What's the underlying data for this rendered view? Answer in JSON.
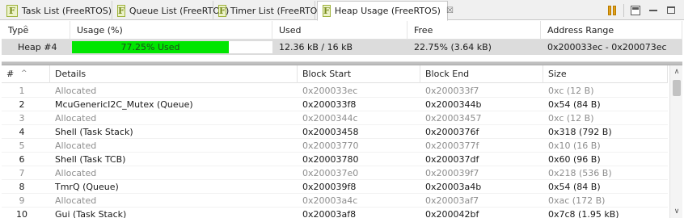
{
  "tabs": [
    {
      "label": "Task List (FreeRTOS)",
      "icon": "freertos-icon",
      "active": false
    },
    {
      "label": "Queue List (FreeRTOS)",
      "icon": "freertos-icon",
      "active": false
    },
    {
      "label": "Timer List (FreeRTOS)",
      "icon": "freertos-icon",
      "active": false
    },
    {
      "label": "Heap Usage (FreeRTOS)",
      "icon": "freertos-icon",
      "active": true,
      "close": "☒"
    }
  ],
  "toolbar": {
    "icons": [
      "pause-icon",
      "save-icon",
      "minimize-icon",
      "maximize-icon"
    ]
  },
  "summary": {
    "headers": {
      "type": "Type",
      "usage": "Usage (%)",
      "used": "Used",
      "free": "Free",
      "address": "Address Range"
    },
    "row": {
      "type": "Heap #4",
      "usage_text": "77.25% Used",
      "usage_fraction": 0.7725,
      "used": "12.36 kB / 16 kB",
      "free": "22.75% (3.64 kB)",
      "address": "0x200033ec - 0x200073ec"
    }
  },
  "blocks": {
    "headers": {
      "num": "#",
      "details": "Details",
      "start": "Block Start",
      "end": "Block End",
      "size": "Size"
    },
    "rows": [
      {
        "num": "1",
        "details": "Allocated",
        "start": "0x200033ec",
        "end": "0x200033f7",
        "size": "0xc (12 B)",
        "grey": true
      },
      {
        "num": "2",
        "details": "McuGenericI2C_Mutex (Queue)",
        "start": "0x200033f8",
        "end": "0x2000344b",
        "size": "0x54 (84 B)",
        "grey": false
      },
      {
        "num": "3",
        "details": "Allocated",
        "start": "0x2000344c",
        "end": "0x20003457",
        "size": "0xc (12 B)",
        "grey": true
      },
      {
        "num": "4",
        "details": "Shell (Task Stack)",
        "start": "0x20003458",
        "end": "0x2000376f",
        "size": "0x318 (792 B)",
        "grey": false
      },
      {
        "num": "5",
        "details": "Allocated",
        "start": "0x20003770",
        "end": "0x2000377f",
        "size": "0x10 (16 B)",
        "grey": true
      },
      {
        "num": "6",
        "details": "Shell (Task TCB)",
        "start": "0x20003780",
        "end": "0x200037df",
        "size": "0x60 (96 B)",
        "grey": false
      },
      {
        "num": "7",
        "details": "Allocated",
        "start": "0x200037e0",
        "end": "0x200039f7",
        "size": "0x218 (536 B)",
        "grey": true
      },
      {
        "num": "8",
        "details": "TmrQ (Queue)",
        "start": "0x200039f8",
        "end": "0x20003a4b",
        "size": "0x54 (84 B)",
        "grey": false
      },
      {
        "num": "9",
        "details": "Allocated",
        "start": "0x20003a4c",
        "end": "0x20003af7",
        "size": "0xac (172 B)",
        "grey": true
      },
      {
        "num": "10",
        "details": "Gui (Task Stack)",
        "start": "0x20003af8",
        "end": "0x200042bf",
        "size": "0x7c8 (1.95 kB)",
        "grey": false
      }
    ]
  },
  "colors": {
    "usage_bar": "#00e600",
    "selected_row": "#dcdcdc",
    "allocated_text": "#8e8e8e"
  }
}
